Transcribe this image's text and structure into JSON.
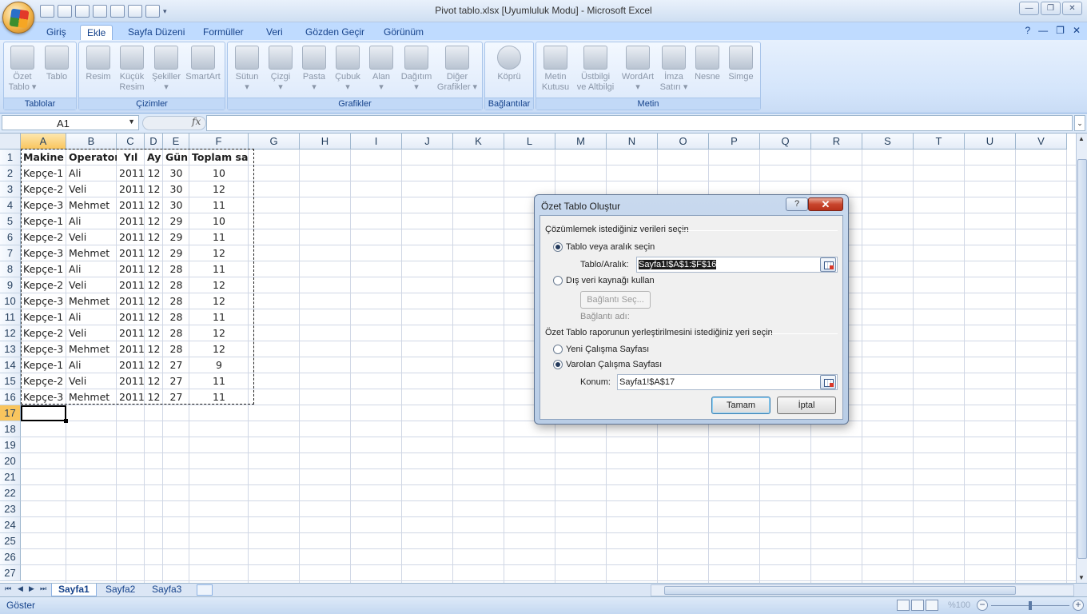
{
  "window": {
    "title": "Pivot tablo.xlsx  [Uyumluluk Modu] - Microsoft Excel",
    "min": "—",
    "max": "❐",
    "close": "✕"
  },
  "ribbon_tabs": [
    "Giriş",
    "Ekle",
    "Sayfa Düzeni",
    "Formüller",
    "Veri",
    "Gözden Geçir",
    "Görünüm"
  ],
  "ribbon_right": {
    "help": "?",
    "min": "—",
    "restore": "❐",
    "close": "✕"
  },
  "ribbon_groups": [
    {
      "label": "Tablolar",
      "buttons": [
        "Özet\nTablo ▾",
        "Tablo"
      ]
    },
    {
      "label": "Çizimler",
      "buttons": [
        "Resim",
        "Küçük\nResim",
        "Şekiller\n▾",
        "SmartArt"
      ]
    },
    {
      "label": "Grafikler",
      "buttons": [
        "Sütun\n▾",
        "Çizgi\n▾",
        "Pasta\n▾",
        "Çubuk\n▾",
        "Alan\n▾",
        "Dağıtım\n▾",
        "Diğer\nGrafikler ▾"
      ]
    },
    {
      "label": "Bağlantılar",
      "buttons": [
        "Köprü"
      ]
    },
    {
      "label": "Metin",
      "buttons": [
        "Metin\nKutusu",
        "Üstbilgi\nve Altbilgi",
        "WordArt\n▾",
        "İmza\nSatırı ▾",
        "Nesne",
        "Simge"
      ]
    }
  ],
  "formula_bar": {
    "name_box": "A1",
    "fx": "fx",
    "value": ""
  },
  "columns": [
    "A",
    "B",
    "C",
    "D",
    "E",
    "F",
    "G",
    "H",
    "I",
    "J",
    "K",
    "L",
    "M",
    "N",
    "O",
    "P",
    "Q",
    "R",
    "S",
    "T",
    "U",
    "V"
  ],
  "table": {
    "headers": [
      "Makine",
      "Operator",
      "Yıl",
      "Ay",
      "Gün",
      "Toplam saat"
    ],
    "rows": [
      [
        "Kepçe-1",
        "Ali",
        "2011",
        "12",
        "30",
        "10"
      ],
      [
        "Kepçe-2",
        "Veli",
        "2011",
        "12",
        "30",
        "12"
      ],
      [
        "Kepçe-3",
        "Mehmet",
        "2011",
        "12",
        "30",
        "11"
      ],
      [
        "Kepçe-1",
        "Ali",
        "2011",
        "12",
        "29",
        "10"
      ],
      [
        "Kepçe-2",
        "Veli",
        "2011",
        "12",
        "29",
        "11"
      ],
      [
        "Kepçe-3",
        "Mehmet",
        "2011",
        "12",
        "29",
        "12"
      ],
      [
        "Kepçe-1",
        "Ali",
        "2011",
        "12",
        "28",
        "11"
      ],
      [
        "Kepçe-2",
        "Veli",
        "2011",
        "12",
        "28",
        "12"
      ],
      [
        "Kepçe-3",
        "Mehmet",
        "2011",
        "12",
        "28",
        "12"
      ],
      [
        "Kepçe-1",
        "Ali",
        "2011",
        "12",
        "28",
        "11"
      ],
      [
        "Kepçe-2",
        "Veli",
        "2011",
        "12",
        "28",
        "12"
      ],
      [
        "Kepçe-3",
        "Mehmet",
        "2011",
        "12",
        "28",
        "12"
      ],
      [
        "Kepçe-1",
        "Ali",
        "2011",
        "12",
        "27",
        "9"
      ],
      [
        "Kepçe-2",
        "Veli",
        "2011",
        "12",
        "27",
        "11"
      ],
      [
        "Kepçe-3",
        "Mehmet",
        "2011",
        "12",
        "27",
        "11"
      ]
    ]
  },
  "sheet_tabs": [
    "Sayfa1",
    "Sayfa2",
    "Sayfa3"
  ],
  "active_sheet": "Sayfa1",
  "status": {
    "mode": "Göster",
    "zoom": "%100",
    "zoom_minus": "−",
    "zoom_plus": "+"
  },
  "dialog": {
    "title": "Özet Tablo Oluştur",
    "help": "?",
    "close": "✕",
    "section1": "Çözümlemek istediğiniz verileri seçin",
    "radio_table": "Tablo veya aralık seçin",
    "table_range_label": "Tablo/Aralık:",
    "table_range_value": "Sayfa1!$A$1:$F$16",
    "radio_external": "Dış veri kaynağı kullan",
    "choose_connection": "Bağlantı Seç...",
    "connection_name_label": "Bağlantı adı:",
    "section2": "Özet Tablo raporunun yerleştirilmesini istediğiniz yeri seçin",
    "radio_new": "Yeni Çalışma Sayfası",
    "radio_existing": "Varolan Çalışma Sayfası",
    "location_label": "Konum:",
    "location_value": "Sayfa1!$A$17",
    "ok": "Tamam",
    "cancel": "İptal"
  }
}
